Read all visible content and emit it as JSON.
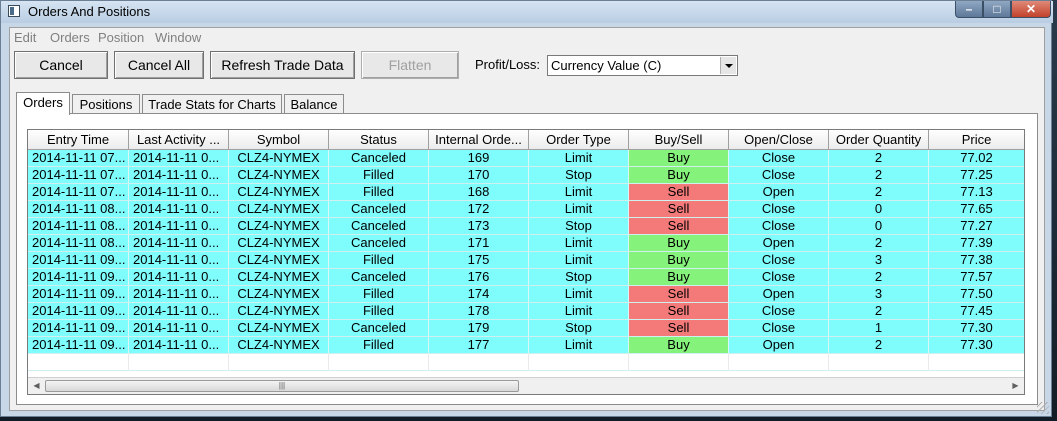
{
  "window": {
    "title": "Orders And Positions"
  },
  "menu": [
    "Edit",
    "Orders",
    "Position",
    "Window"
  ],
  "toolbar": {
    "cancel": "Cancel",
    "cancel_all": "Cancel All",
    "refresh": "Refresh Trade Data",
    "flatten": "Flatten",
    "pl_label": "Profit/Loss:",
    "pl_value": "Currency Value (C)"
  },
  "tabs": [
    "Orders",
    "Positions",
    "Trade Stats for Charts",
    "Balance"
  ],
  "grid": {
    "columns": [
      "Entry Time",
      "Last Activity ...",
      "Symbol",
      "Status",
      "Internal Orde...",
      "Order Type",
      "Buy/Sell",
      "Open/Close",
      "Order Quantity",
      "Price"
    ],
    "rows": [
      [
        "2014-11-11 07...",
        "2014-11-11 0...",
        "CLZ4-NYMEX",
        "Canceled",
        "169",
        "Limit",
        "Buy",
        "Close",
        "2",
        "77.02"
      ],
      [
        "2014-11-11 07...",
        "2014-11-11 0...",
        "CLZ4-NYMEX",
        "Filled",
        "170",
        "Stop",
        "Buy",
        "Close",
        "2",
        "77.25"
      ],
      [
        "2014-11-11 07...",
        "2014-11-11 0...",
        "CLZ4-NYMEX",
        "Filled",
        "168",
        "Limit",
        "Sell",
        "Open",
        "2",
        "77.13"
      ],
      [
        "2014-11-11 08...",
        "2014-11-11 0...",
        "CLZ4-NYMEX",
        "Canceled",
        "172",
        "Limit",
        "Sell",
        "Close",
        "0",
        "77.65"
      ],
      [
        "2014-11-11 08...",
        "2014-11-11 0...",
        "CLZ4-NYMEX",
        "Canceled",
        "173",
        "Stop",
        "Sell",
        "Close",
        "0",
        "77.27"
      ],
      [
        "2014-11-11 08...",
        "2014-11-11 0...",
        "CLZ4-NYMEX",
        "Canceled",
        "171",
        "Limit",
        "Buy",
        "Open",
        "2",
        "77.39"
      ],
      [
        "2014-11-11 09...",
        "2014-11-11 0...",
        "CLZ4-NYMEX",
        "Filled",
        "175",
        "Limit",
        "Buy",
        "Close",
        "3",
        "77.38"
      ],
      [
        "2014-11-11 09...",
        "2014-11-11 0...",
        "CLZ4-NYMEX",
        "Canceled",
        "176",
        "Stop",
        "Buy",
        "Close",
        "2",
        "77.57"
      ],
      [
        "2014-11-11 09...",
        "2014-11-11 0...",
        "CLZ4-NYMEX",
        "Filled",
        "174",
        "Limit",
        "Sell",
        "Open",
        "3",
        "77.50"
      ],
      [
        "2014-11-11 09...",
        "2014-11-11 0...",
        "CLZ4-NYMEX",
        "Filled",
        "178",
        "Limit",
        "Sell",
        "Close",
        "2",
        "77.45"
      ],
      [
        "2014-11-11 09...",
        "2014-11-11 0...",
        "CLZ4-NYMEX",
        "Canceled",
        "179",
        "Stop",
        "Sell",
        "Close",
        "1",
        "77.30"
      ],
      [
        "2014-11-11 09...",
        "2014-11-11 0...",
        "CLZ4-NYMEX",
        "Filled",
        "177",
        "Limit",
        "Buy",
        "Open",
        "2",
        "77.30"
      ]
    ]
  },
  "colors": {
    "row": "#7ffcfc",
    "buy": "#85f27b",
    "sell": "#f47a7a"
  }
}
